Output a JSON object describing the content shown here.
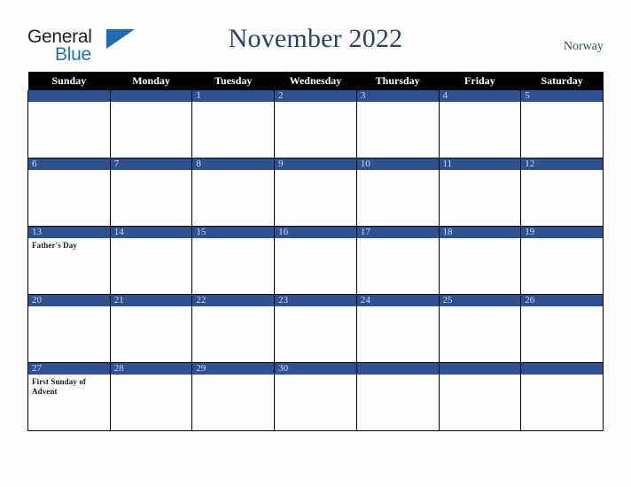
{
  "brand": {
    "name_part1": "General",
    "name_part2": "Blue"
  },
  "header": {
    "title": "November 2022",
    "country": "Norway"
  },
  "colors": {
    "day_bar": "#2d5294",
    "weekday_header_bg": "#000000",
    "title": "#2d4269",
    "brand_blue": "#1b75bc"
  },
  "calendar": {
    "weekdays": [
      "Sunday",
      "Monday",
      "Tuesday",
      "Wednesday",
      "Thursday",
      "Friday",
      "Saturday"
    ],
    "weeks": [
      [
        {
          "day": "",
          "events": []
        },
        {
          "day": "",
          "events": []
        },
        {
          "day": "1",
          "events": []
        },
        {
          "day": "2",
          "events": []
        },
        {
          "day": "3",
          "events": []
        },
        {
          "day": "4",
          "events": []
        },
        {
          "day": "5",
          "events": []
        }
      ],
      [
        {
          "day": "6",
          "events": []
        },
        {
          "day": "7",
          "events": []
        },
        {
          "day": "8",
          "events": []
        },
        {
          "day": "9",
          "events": []
        },
        {
          "day": "10",
          "events": []
        },
        {
          "day": "11",
          "events": []
        },
        {
          "day": "12",
          "events": []
        }
      ],
      [
        {
          "day": "13",
          "events": [
            "Father's Day"
          ]
        },
        {
          "day": "14",
          "events": []
        },
        {
          "day": "15",
          "events": []
        },
        {
          "day": "16",
          "events": []
        },
        {
          "day": "17",
          "events": []
        },
        {
          "day": "18",
          "events": []
        },
        {
          "day": "19",
          "events": []
        }
      ],
      [
        {
          "day": "20",
          "events": []
        },
        {
          "day": "21",
          "events": []
        },
        {
          "day": "22",
          "events": []
        },
        {
          "day": "23",
          "events": []
        },
        {
          "day": "24",
          "events": []
        },
        {
          "day": "25",
          "events": []
        },
        {
          "day": "26",
          "events": []
        }
      ],
      [
        {
          "day": "27",
          "events": [
            "First Sunday of Advent"
          ]
        },
        {
          "day": "28",
          "events": []
        },
        {
          "day": "29",
          "events": []
        },
        {
          "day": "30",
          "events": []
        },
        {
          "day": "",
          "events": []
        },
        {
          "day": "",
          "events": []
        },
        {
          "day": "",
          "events": []
        }
      ]
    ]
  }
}
